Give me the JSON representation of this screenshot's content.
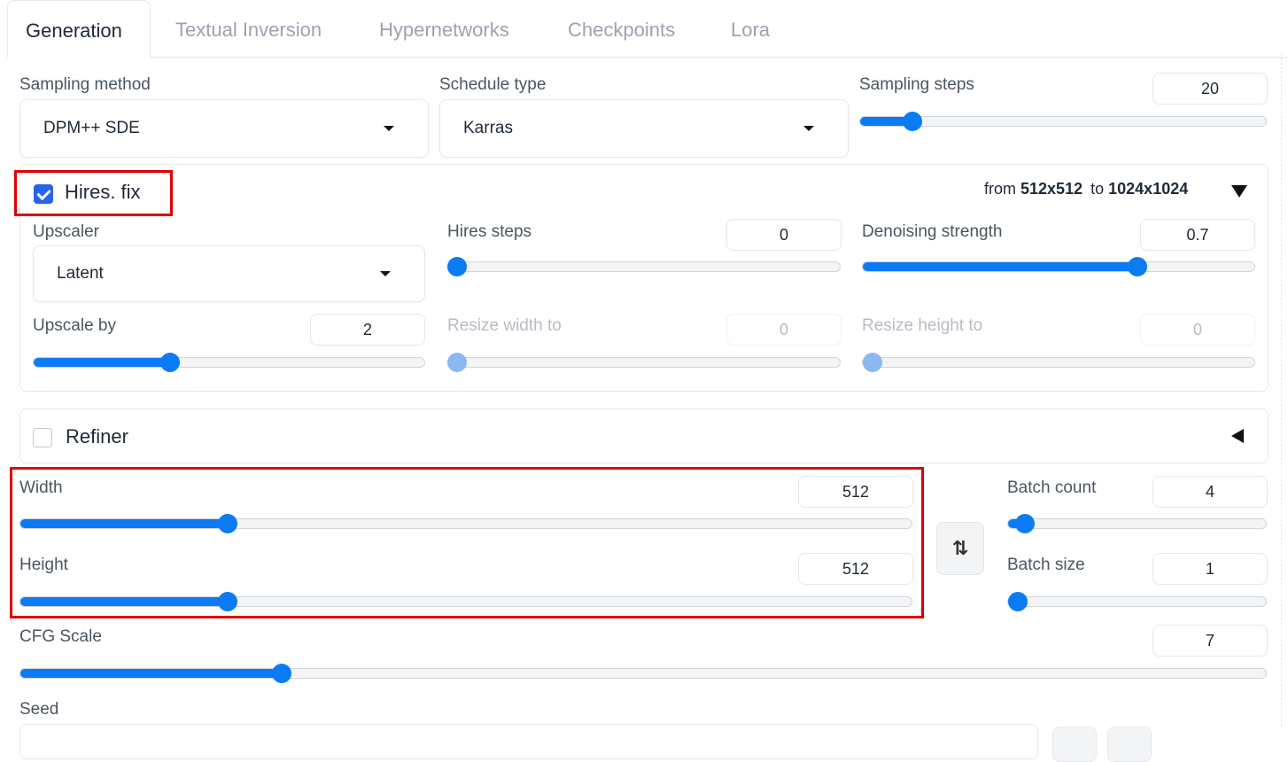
{
  "tabs": [
    {
      "label": "Generation",
      "active": true
    },
    {
      "label": "Textual Inversion",
      "active": false
    },
    {
      "label": "Hypernetworks",
      "active": false
    },
    {
      "label": "Checkpoints",
      "active": false
    },
    {
      "label": "Lora",
      "active": false
    }
  ],
  "sampling": {
    "method_label": "Sampling method",
    "method_value": "DPM++ SDE",
    "schedule_label": "Schedule type",
    "schedule_value": "Karras",
    "steps_label": "Sampling steps",
    "steps_value": "20",
    "steps_fraction": 0.13
  },
  "hires": {
    "enabled": true,
    "label": "Hires. fix",
    "summary_from": "from",
    "summary_from_size": "512x512",
    "summary_to": "to",
    "summary_to_size": "1024x1024",
    "upscaler_label": "Upscaler",
    "upscaler_value": "Latent",
    "steps_label": "Hires steps",
    "steps_value": "0",
    "steps_fraction": 0.0,
    "denoise_label": "Denoising strength",
    "denoise_value": "0.7",
    "denoise_fraction": 0.7,
    "upscale_by_label": "Upscale by",
    "upscale_by_value": "2",
    "upscale_by_fraction": 0.35,
    "resize_width_label": "Resize width to",
    "resize_width_value": "0",
    "resize_height_label": "Resize height to",
    "resize_height_value": "0"
  },
  "refiner": {
    "enabled": false,
    "label": "Refiner"
  },
  "dimensions": {
    "width_label": "Width",
    "width_value": "512",
    "width_fraction": 0.233,
    "height_label": "Height",
    "height_value": "512",
    "height_fraction": 0.233,
    "swap_icon": "⇅"
  },
  "batch": {
    "count_label": "Batch count",
    "count_value": "4",
    "count_fraction": 0.03,
    "size_label": "Batch size",
    "size_value": "1",
    "size_fraction": 0.0
  },
  "cfg": {
    "label": "CFG Scale",
    "value": "7",
    "fraction": 0.21
  },
  "seed": {
    "label": "Seed"
  },
  "colors": {
    "accent": "#0b7bf5",
    "checkbox": "#2563eb",
    "highlight": "#e00000"
  }
}
